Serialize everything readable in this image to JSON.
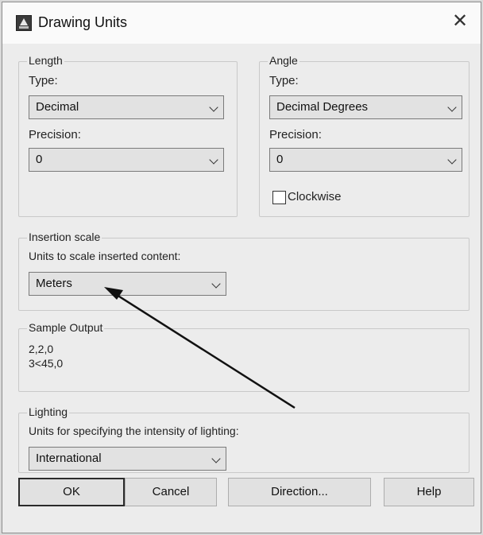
{
  "window": {
    "title": "Drawing Units",
    "close_glyph": "✕"
  },
  "length": {
    "legend": "Length",
    "type_label": "Type:",
    "type_value": "Decimal",
    "precision_label": "Precision:",
    "precision_value": "0"
  },
  "angle": {
    "legend": "Angle",
    "type_label": "Type:",
    "type_value": "Decimal Degrees",
    "precision_label": "Precision:",
    "precision_value": "0",
    "clockwise_label": "Clockwise",
    "clockwise_checked": false
  },
  "insertion": {
    "legend": "Insertion scale",
    "label": "Units to scale inserted content:",
    "value": "Meters"
  },
  "sample": {
    "legend": "Sample Output",
    "line1": "2,2,0",
    "line2": "3<45,0"
  },
  "lighting": {
    "legend": "Lighting",
    "label": "Units for specifying the intensity of lighting:",
    "value": "International"
  },
  "buttons": {
    "ok": "OK",
    "cancel": "Cancel",
    "direction": "Direction...",
    "help": "Help"
  },
  "icons": [
    "autocad-app-icon",
    "close-icon",
    "chevron-down-icon",
    "checkbox",
    "annotation-arrow"
  ]
}
